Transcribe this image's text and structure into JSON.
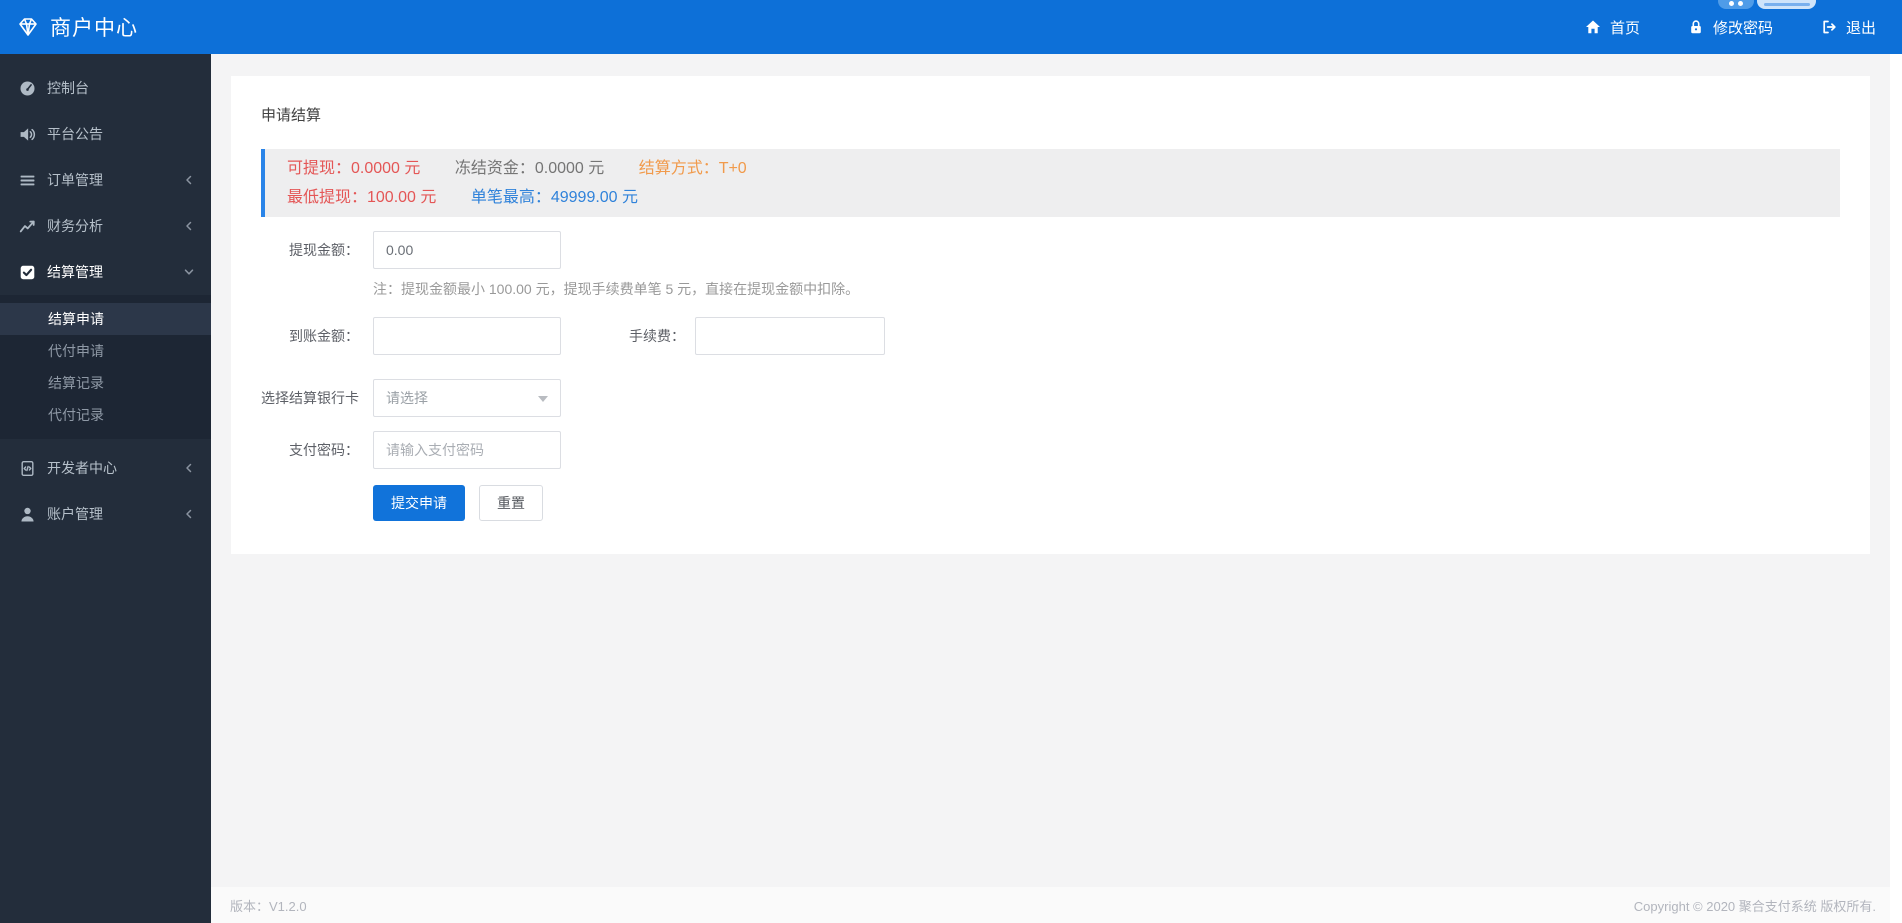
{
  "header": {
    "logo_text": "商户中心",
    "nav": [
      {
        "label": "首页",
        "icon": "home-icon"
      },
      {
        "label": "修改密码",
        "icon": "lock-icon"
      },
      {
        "label": "退出",
        "icon": "signout-icon"
      }
    ]
  },
  "sidebar": {
    "items": [
      {
        "label": "控制台",
        "icon": "gauge-icon",
        "chevron": "none"
      },
      {
        "label": "平台公告",
        "icon": "announcement-icon",
        "chevron": "none"
      },
      {
        "label": "订单管理",
        "icon": "list-icon",
        "chevron": "left"
      },
      {
        "label": "财务分析",
        "icon": "chart-line-icon",
        "chevron": "left"
      },
      {
        "label": "结算管理",
        "icon": "check-square-icon",
        "chevron": "down",
        "expanded": true
      },
      {
        "label": "开发者中心",
        "icon": "file-code-icon",
        "chevron": "left"
      },
      {
        "label": "账户管理",
        "icon": "user-icon",
        "chevron": "left"
      }
    ],
    "submenu": {
      "parent": "结算管理",
      "active_item": "结算申请",
      "items": [
        {
          "label": "结算申请",
          "active": true
        },
        {
          "label": "代付申请",
          "active": false
        },
        {
          "label": "结算记录",
          "active": false
        },
        {
          "label": "代付记录",
          "active": false
        }
      ]
    }
  },
  "main": {
    "title": "申请结算",
    "alert": {
      "available": "可提现：0.0000 元",
      "frozen": "冻结资金：0.0000 元",
      "method": "结算方式：T+0",
      "min_withdraw": "最低提现：100.00 元",
      "max_single": "单笔最高：49999.00 元"
    },
    "form": {
      "withdraw_label": "提现金额：",
      "withdraw_value": "0.00",
      "note": "注：提现金额最小 100.00 元，提现手续费单笔 5 元，直接在提现金额中扣除。",
      "arrival_label": "到账金额：",
      "fee_label": "手续费：",
      "bank_label": "选择结算银行卡",
      "bank_selected": "请选择",
      "password_label": "支付密码：",
      "password_placeholder": "请输入支付密码",
      "submit_label": "提交申请",
      "reset_label": "重置"
    }
  },
  "footer": {
    "version": "版本：V1.2.0",
    "copyright": "Copyright © 2020 聚合支付系统 版权所有."
  },
  "colors": {
    "header_blue": "#0d70d8",
    "sidebar_bg": "#232d3b",
    "submenu_bg": "#1d2634",
    "alert_border_blue": "#2a84e8",
    "alert_bg": "#eeeeef",
    "text_red": "#e45656",
    "text_orange": "#f19a4b",
    "text_blue": "#2f82da",
    "button_blue": "#1173da"
  }
}
